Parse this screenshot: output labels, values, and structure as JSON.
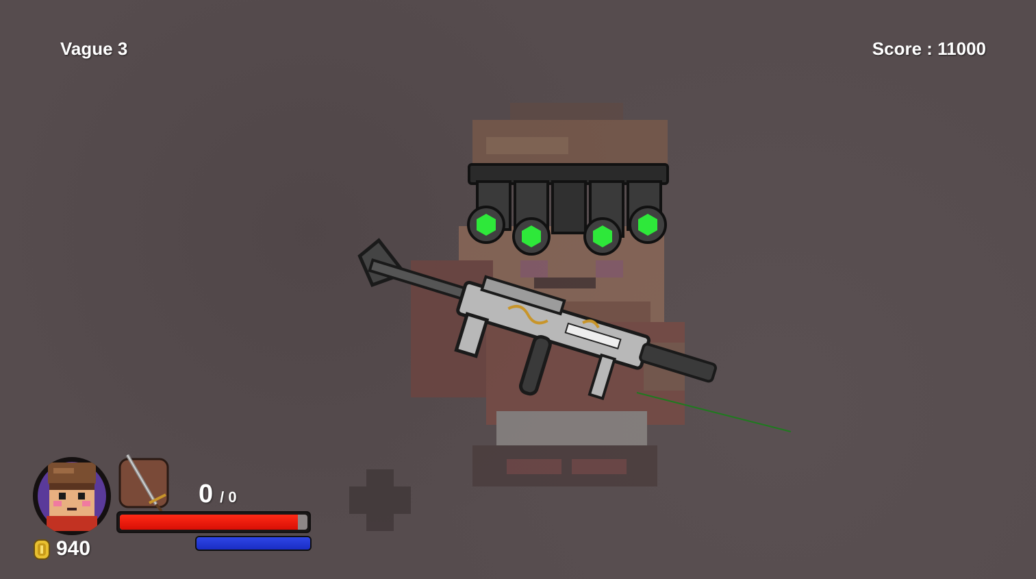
{
  "hud": {
    "wave_label": "Vague 3",
    "score_label": "Score : 11000",
    "ammo_current": "0",
    "ammo_max": "/ 0",
    "coins": "940",
    "health_fraction": 0.95,
    "mana_fraction": 1.0
  },
  "icons": {
    "weapon": "sword-icon",
    "currency": "coin-icon",
    "character": "player-portrait"
  },
  "colors": {
    "background": "#564c4e",
    "health": "#e8190b",
    "mana": "#2238d8",
    "night_vision_lens": "#2ee83a"
  }
}
